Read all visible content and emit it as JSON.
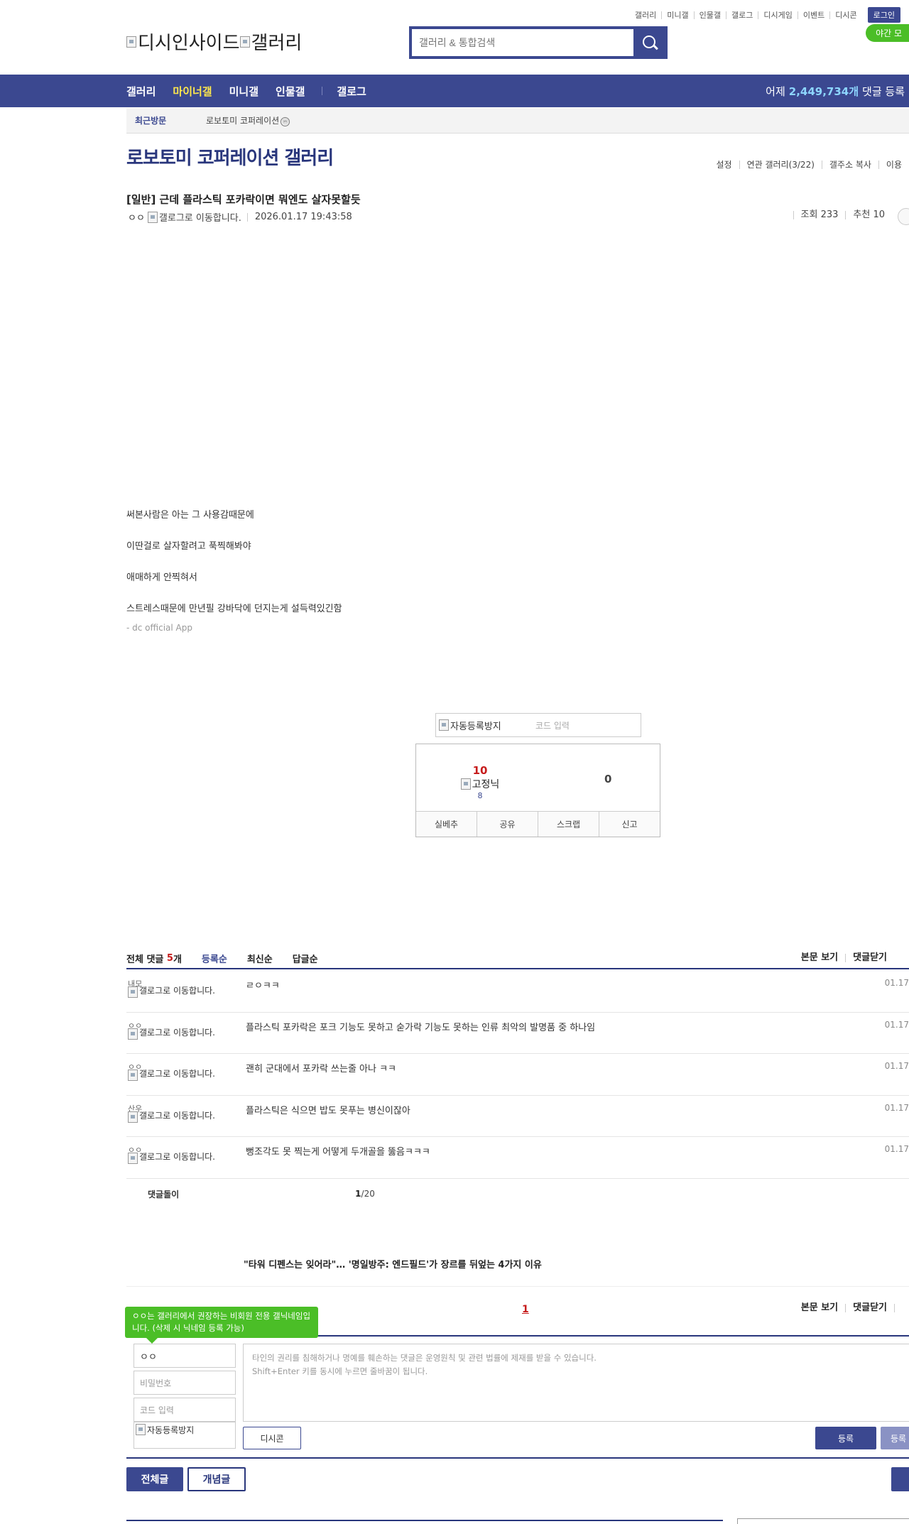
{
  "util_links": [
    "갤러리",
    "미니갤",
    "인물갤",
    "갤로그",
    "디시게임",
    "이벤트",
    "디시콘"
  ],
  "login_label": "로그인",
  "night_mode_label": "야간 모",
  "logo": {
    "alt1": "디시인사이드",
    "alt2": "갤러리"
  },
  "search": {
    "placeholder": "갤러리 & 통합검색"
  },
  "gnb": {
    "items": [
      "갤러리",
      "마이너갤",
      "미니갤",
      "인물갤",
      "갤로그"
    ],
    "stat_prefix": "어제",
    "stat_count": "2,449,734개",
    "stat_suffix": "댓글 등록"
  },
  "recent": {
    "label": "최근방문",
    "item": "로보토미 코퍼레이션",
    "mark": "ⓜ"
  },
  "gallery": {
    "title": "로보토미 코퍼레이션 갤러리",
    "tools": [
      "설정",
      "연관 갤러리(3/22)",
      "갤주소 복사",
      "이용"
    ]
  },
  "post": {
    "title": "[일반] 근데 플라스틱 포카락이면 뭐엔도 살자못할듯",
    "author": "ㅇㅇ",
    "gallog_alt": "갤로그로 이동합니다.",
    "date": "2026.01.17 19:43:58",
    "views": "조회 233",
    "recommend": "추천 10",
    "body": [
      "써본사람은 아는 그 사용감때문에",
      "이딴걸로 살자할려고 푹찍해봐야",
      "애매하게 안찍혀서",
      "스트레스때문에 만년필 강바닥에 던지는게 설득력있긴함"
    ],
    "app_sig": "- dc official App"
  },
  "captcha": {
    "img_alt": "자동등록방지",
    "placeholder": "코드 입력"
  },
  "recommend_box": {
    "up": "10",
    "fixed_alt": "고정닉",
    "fixed_count": "8",
    "down": "0",
    "actions": [
      "실베추",
      "공유",
      "스크랩",
      "신고"
    ]
  },
  "comments": {
    "label": "전체 댓글",
    "count": "5",
    "count_unit": "개",
    "sorts": [
      "등록순",
      "최신순",
      "답글순"
    ],
    "right": [
      "본문 보기",
      "댓글닫기",
      ""
    ],
    "items": [
      {
        "nick": "내모",
        "alt": "갤로그로 이동합니다.",
        "text": "ㄹㅇㅋㅋ",
        "time": "01.17"
      },
      {
        "nick": "ㅇㅇ",
        "alt": "갤로그로 이동합니다.",
        "text": "플라스틱 포카락은 포크 기능도 못하고 숟가락 기능도 못하는 인류 최악의 발명품 중 하나임",
        "time": "01.17"
      },
      {
        "nick": "ㅇㅇ",
        "alt": "갤로그로 이동합니다.",
        "text": "괜히 군대에서 포카락 쓰는줄 아나 ㅋㅋ",
        "time": "01.17"
      },
      {
        "nick": "산우",
        "alt": "갤로그로 이동합니다.",
        "text": "플라스틱은 식으면 밥도 못푸는 병신이잖아",
        "time": "01.17"
      },
      {
        "nick": "ㅇㅇ",
        "alt": "갤로그로 이동합니다.",
        "text": "뻥조각도 못 찍는게 어떻게 두개골을 뚫음ㅋㅋㅋ",
        "time": "01.17"
      }
    ],
    "bot_label": "댓글돌이",
    "page_current": "1",
    "page_total": "/20"
  },
  "news": {
    "headline": "\"타워 디펜스는 잊어라\"… '명일방주: 엔드필드'가 장르를 뒤엎는 4가지 이유"
  },
  "pager": {
    "current": "1",
    "right": [
      "본문 보기",
      "댓글닫기",
      ""
    ]
  },
  "tip": {
    "text": "ㅇㅇ는 갤러리에서 권장하는 비회원 전용 갤닉네임입니다. (삭제 시 닉네임 등록 가능)"
  },
  "write": {
    "nick_value": "ㅇㅇ",
    "password_placeholder": "비밀번호",
    "code_placeholder": "코드 입력",
    "captcha_alt": "자동등록방지",
    "textarea_line1": "타인의 권리를 침해하거나 명예를 훼손하는 댓글은 운영원칙 및 관련 법률에 제재를 받을 수 있습니다.",
    "textarea_line2": "Shift+Enter 키를 동시에 누르면 줄바꿈이 됩니다.",
    "dccon_label": "디시콘",
    "submit_label": "등록",
    "submit2_label": "등록"
  },
  "bottom": {
    "all_label": "전체글",
    "concept_label": "개념글"
  }
}
